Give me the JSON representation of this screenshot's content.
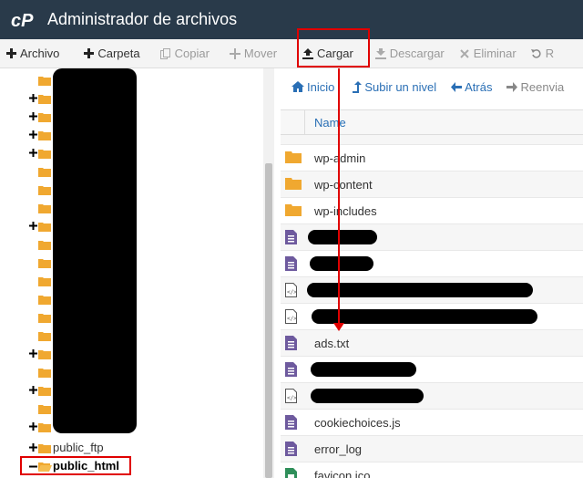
{
  "header": {
    "title": "Administrador de archivos",
    "logo_text": "cP"
  },
  "toolbar": {
    "archivo": "Archivo",
    "carpeta": "Carpeta",
    "copiar": "Copiar",
    "mover": "Mover",
    "cargar": "Cargar",
    "descargar": "Descargar",
    "eliminar": "Eliminar",
    "restaurar": "R"
  },
  "nav": {
    "inicio": "Inicio",
    "subir": "Subir un nivel",
    "atras": "Atrás",
    "reenviar": "Reenvia"
  },
  "tree": {
    "public_ftp": "public_ftp",
    "public_html": "public_html"
  },
  "files": {
    "header_name": "Name",
    "rows": [
      {
        "name": "wp-admin",
        "icon": "folder-icon"
      },
      {
        "name": "wp-content",
        "icon": "folder-icon"
      },
      {
        "name": "wp-includes",
        "icon": "folder-icon"
      },
      {
        "name": "",
        "icon": "document-icon"
      },
      {
        "name": "",
        "icon": "document-icon"
      },
      {
        "name": "",
        "icon": "code-file-icon"
      },
      {
        "name": "",
        "icon": "code-file-icon"
      },
      {
        "name": "ads.txt",
        "icon": "document-icon"
      },
      {
        "name": "",
        "icon": "document-icon"
      },
      {
        "name": "",
        "icon": "code-file-icon"
      },
      {
        "name": "cookiechoices.js",
        "icon": "document-icon"
      },
      {
        "name": "error_log",
        "icon": "document-icon"
      },
      {
        "name": "favicon.ico",
        "icon": "image-file-icon"
      }
    ]
  },
  "colors": {
    "header_bg": "#293a4a",
    "link_blue": "#2a6fb5",
    "folder_orange": "#f0a830",
    "file_purple": "#6e5a9e",
    "annotation_red": "#e00000"
  }
}
